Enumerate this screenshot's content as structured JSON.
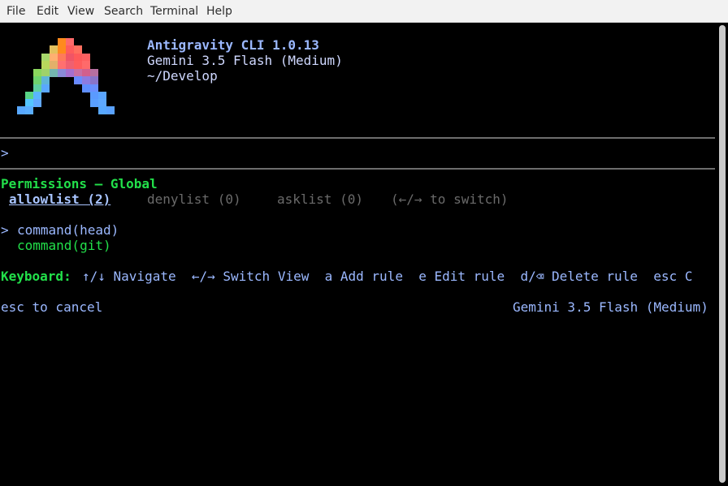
{
  "menu": {
    "items": [
      "File",
      "Edit",
      "View",
      "Search",
      "Terminal",
      "Help"
    ]
  },
  "header": {
    "app_title": "Antigravity CLI 1.0.13",
    "model": "Gemini 3.5 Flash (Medium)",
    "cwd": "~/Develop"
  },
  "prompt": {
    "symbol": ">"
  },
  "permissions": {
    "title": "Permissions – Global",
    "tabs": {
      "allowlist": "allowlist (2)",
      "denylist": "denylist (0)",
      "asklist": "asklist (0)",
      "switch_hint": "(←/→ to switch)"
    },
    "cursor": ">",
    "rules": [
      "command(head)",
      "command(git)"
    ]
  },
  "keyboard": {
    "label": "Keyboard:",
    "hints": "↑/↓ Navigate  ←/→ Switch View  a Add rule  e Edit rule  d/⌫ Delete rule  esc C"
  },
  "footer": {
    "cancel": "esc to cancel",
    "model": "Gemini 3.5 Flash (Medium)"
  },
  "colors": {
    "accent_blue": "#8fb4ff",
    "green": "#22e04a",
    "dim": "#6a6a6a",
    "text_light": "#cfd8ff"
  }
}
